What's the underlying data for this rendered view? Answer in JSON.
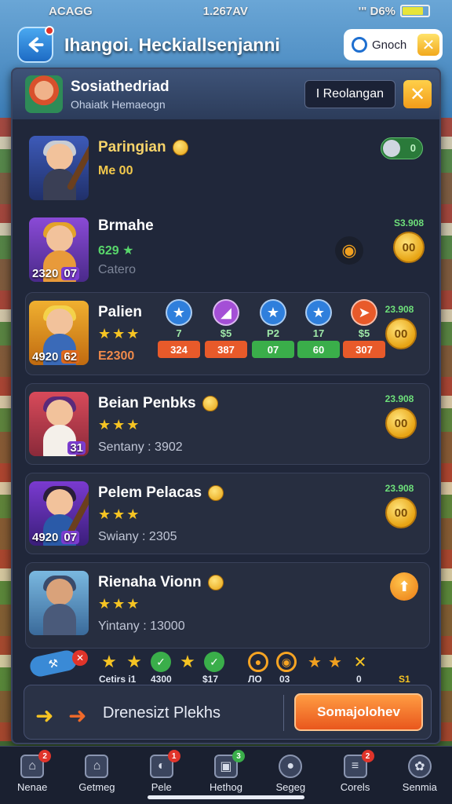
{
  "status_bar": {
    "left": "ACAGG",
    "center": "1.267AV",
    "right": "'\" D6%",
    "battery_level": 0.8
  },
  "top_bar": {
    "title": "Ihangoi. Heckiallsenjanni",
    "search_label": "Gnoch",
    "close_glyph": "✕"
  },
  "panel_header": {
    "title": "Sosiathedriad",
    "subtitle": "Ohaiatk Hemaeogn",
    "button_label": "I  Reolangan",
    "close_glyph": "✕"
  },
  "rows": [
    {
      "name": "Paringian",
      "sub": "Me 00",
      "toggle_value": "0"
    },
    {
      "name": "Brmahe",
      "rate": "629",
      "sub": "Catero",
      "badge": "2320",
      "level": "07",
      "coin_top": "S3.908",
      "coin_value": "00"
    },
    {
      "name": "Palien",
      "stars": "★★★",
      "price": "E2300",
      "badge": "4920",
      "level": "62",
      "coin_top": "23.908",
      "coin_value": "00",
      "skills": [
        {
          "icon": "★",
          "num": "7",
          "value": "324",
          "color": "#2f7fdc",
          "val_bg": "#e85a2a"
        },
        {
          "icon": "◢",
          "num": "$5",
          "value": "387",
          "color": "#a44fd6",
          "val_bg": "#e85a2a"
        },
        {
          "icon": "★",
          "num": "P2",
          "value": "07",
          "color": "#2f7fdc",
          "val_bg": "#3aae4a"
        },
        {
          "icon": "★",
          "num": "17",
          "value": "60",
          "color": "#2f7fdc",
          "val_bg": "#3aae4a"
        },
        {
          "icon": "➤",
          "num": "$5",
          "value": "307",
          "color": "#e85a2a",
          "val_bg": "#e85a2a"
        }
      ]
    },
    {
      "name": "Beian Penbks",
      "stars": "★★★",
      "sub": "Sentany : 3902",
      "level": "31",
      "coin_top": "23.908",
      "coin_value": "00"
    },
    {
      "name": "Pelem Pelacas",
      "stars": "★★★",
      "sub": "Swiany : 2305",
      "badge": "4920",
      "level": "07",
      "coin_top": "23.908",
      "coin_value": "00"
    },
    {
      "name": "Rienaha Vionn",
      "stars": "★★★",
      "sub": "Yintany : 13000",
      "action_glyph": "⬆"
    }
  ],
  "mini_strip": {
    "labels": [
      "Cetirs i1",
      "4300",
      "$17",
      "ЛО",
      "03",
      "0",
      "Ѕ1"
    ]
  },
  "action_bar": {
    "text": "Drenesizt Plekhs",
    "primary_label": "Somajolohev"
  },
  "nav": [
    {
      "label": "Nenae",
      "badge": "2",
      "badge_color": "#e0342a",
      "icon": "⌂"
    },
    {
      "label": "Getmeg",
      "badge": "",
      "badge_color": "",
      "icon": "⌂"
    },
    {
      "label": "Pele",
      "badge": "1",
      "badge_color": "#e0342a",
      "icon": "◐"
    },
    {
      "label": "Hethog",
      "badge": "3",
      "badge_color": "#3aae4a",
      "icon": "▣"
    },
    {
      "label": "Segeg",
      "badge": "",
      "badge_color": "",
      "icon": "●"
    },
    {
      "label": "Corels",
      "badge": "2",
      "badge_color": "#e0342a",
      "icon": "≡"
    },
    {
      "label": "Senmia",
      "badge": "",
      "badge_color": "",
      "icon": "✿"
    }
  ]
}
